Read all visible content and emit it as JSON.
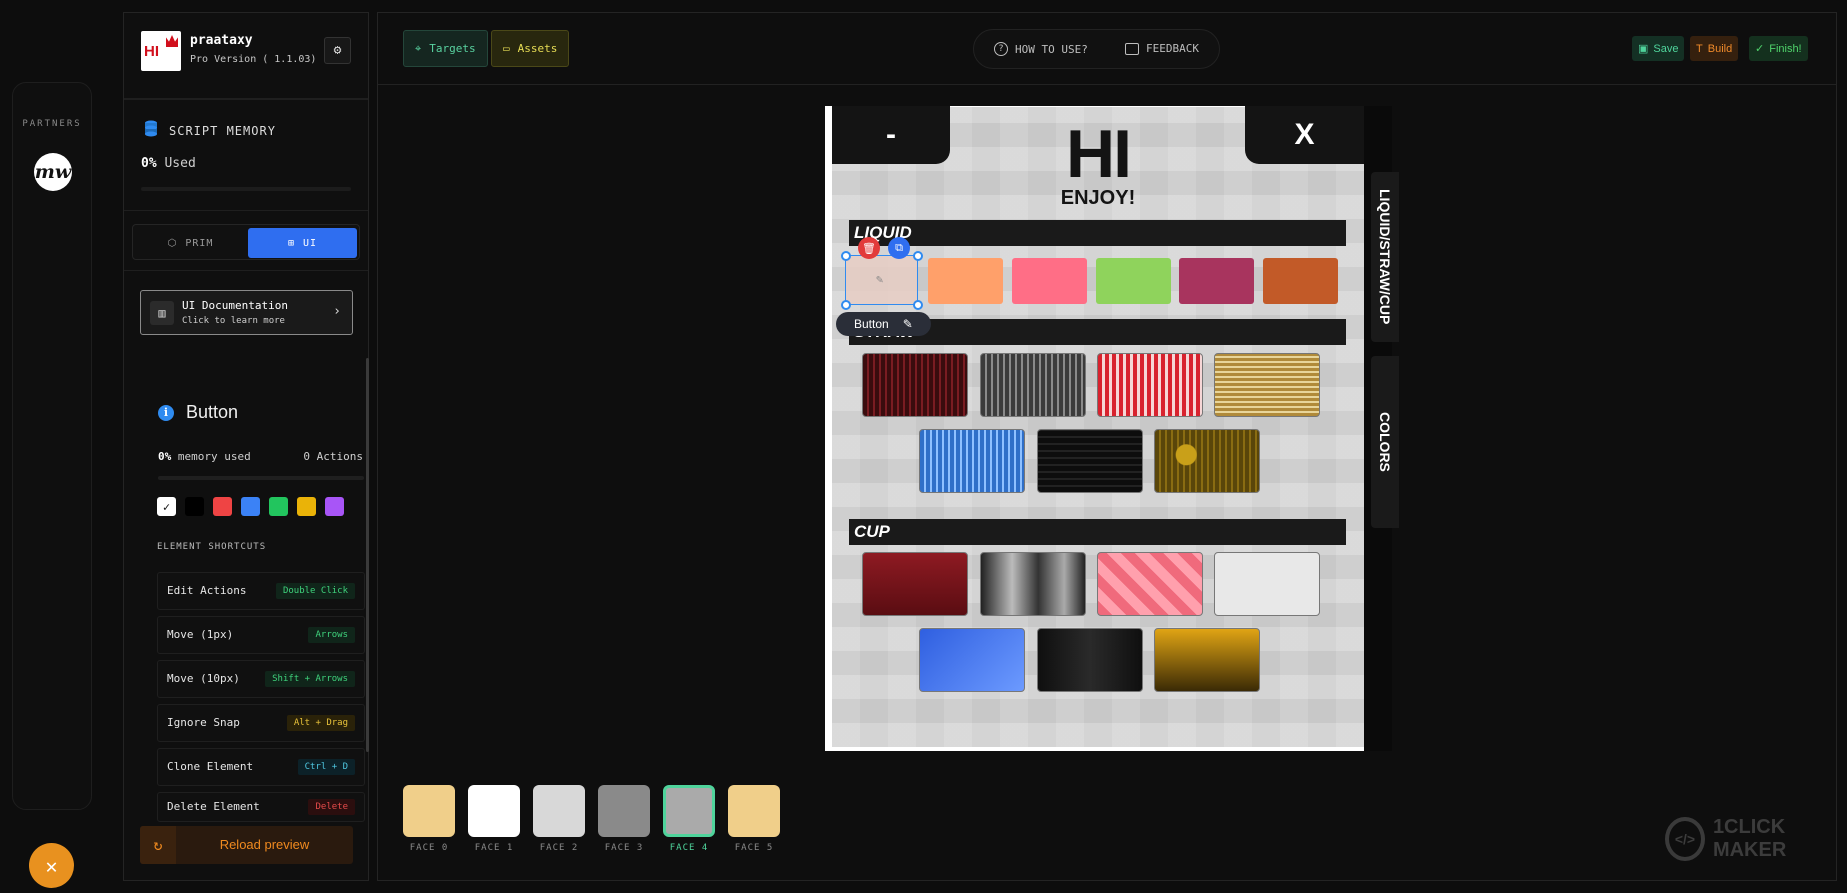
{
  "partners": {
    "label": "PARTNERS",
    "logo_text": "mw"
  },
  "app": {
    "name": "praataxy",
    "version": "Pro Version ( 1.1.03)",
    "logo_text": "HI"
  },
  "memory": {
    "title": "SCRIPT MEMORY",
    "percent": "0%",
    "used_label": "Used"
  },
  "mode": {
    "prim": "PRIM",
    "ui": "UI",
    "active": "UI"
  },
  "ui_doc": {
    "title": "UI Documentation",
    "subtitle": "Click to learn more"
  },
  "element": {
    "name": "Button",
    "memory_percent": "0%",
    "memory_label": "memory used",
    "actions": "0 Actions",
    "swatches": [
      "#ffffff",
      "#000000",
      "#ef4444",
      "#3b82f6",
      "#22c55e",
      "#eab308",
      "#a855f7"
    ],
    "selected_swatch": "#ffffff"
  },
  "shortcuts": {
    "title": "ELEMENT SHORTCUTS",
    "items": [
      {
        "label": "Edit Actions",
        "key": "Double Click"
      },
      {
        "label": "Move (1px)",
        "key": "Arrows"
      },
      {
        "label": "Move (10px)",
        "key": "Shift + Arrows"
      },
      {
        "label": "Ignore Snap",
        "key": "Alt + Drag"
      },
      {
        "label": "Clone Element",
        "key": "Ctrl + D"
      },
      {
        "label": "Delete Element",
        "key": "Delete"
      }
    ]
  },
  "reload": {
    "label": "Reload preview"
  },
  "topbar": {
    "targets": "Targets",
    "assets": "Assets",
    "how_to_use": "HOW TO USE?",
    "feedback": "FEEDBACK",
    "save": "Save",
    "build": "Build",
    "finish": "Finish!"
  },
  "preview": {
    "minus": "-",
    "close": "X",
    "heading": "HI",
    "subheading": "ENJOY!",
    "sections": {
      "liquid": "LIQUID",
      "straw": "STRAW",
      "cup": "CUP"
    },
    "side_tabs": [
      "LIQUID/STRAW/CUP",
      "COLORS"
    ],
    "liquid_colors": [
      "#ffa06a",
      "#ff6e86",
      "#8fd35c",
      "#a8345e",
      "#c25a28"
    ],
    "selected_label": "Button"
  },
  "faces": [
    {
      "label": "FACE 0",
      "color": "#f0cf8a"
    },
    {
      "label": "FACE 1",
      "color": "#ffffff"
    },
    {
      "label": "FACE 2",
      "color": "#d8d8d8"
    },
    {
      "label": "FACE 3",
      "color": "#8a8a8a"
    },
    {
      "label": "FACE 4",
      "color": "#aaaaaa",
      "active": true
    },
    {
      "label": "FACE 5",
      "color": "#f0cf8a"
    }
  ],
  "watermark": {
    "text": "1CLICK MAKER"
  },
  "colors": {
    "accent_blue": "#2f6ef0",
    "accent_orange": "#e8911f",
    "active_face": "#4fd39b"
  }
}
